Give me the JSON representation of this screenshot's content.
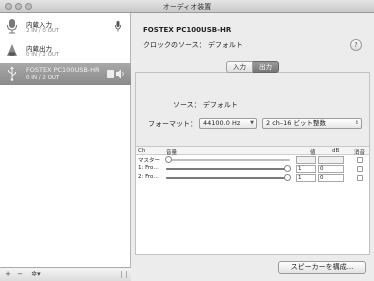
{
  "window": {
    "title": "オーディオ装置"
  },
  "sidebar": {
    "devices": [
      {
        "name": "内蔵入力",
        "io": "2 IN / 0 OUT",
        "icon": "microphone-icon",
        "selected": false
      },
      {
        "name": "内蔵出力",
        "io": "0 IN / 2 OUT",
        "icon": "speaker-icon",
        "selected": false
      },
      {
        "name": "FOSTEX PC100USB-HR",
        "io": "0 IN / 2 OUT",
        "icon": "usb-icon",
        "selected": true
      }
    ],
    "footer": {
      "add": "+",
      "remove": "−",
      "gear": "✲▾"
    }
  },
  "main": {
    "device_title": "FOSTEX PC100USB-HR",
    "clock_source": "クロックのソース： デフォルト",
    "help": "?",
    "tabs": [
      {
        "label": "入力",
        "active": false
      },
      {
        "label": "出力",
        "active": true
      }
    ],
    "source": "ソース： デフォルト",
    "format_label": "フォーマット：",
    "sample_rate": "44100.0 Hz",
    "channel_format": "2 ch–16 ビット整数",
    "table": {
      "headers": {
        "ch": "Ch",
        "volume": "音量",
        "value": "値",
        "db": "dB",
        "mute": "消音"
      },
      "rows": [
        {
          "label": "マスター",
          "level": 0,
          "value": "",
          "db": ""
        },
        {
          "label": "1: Fro…",
          "level": 1,
          "value": "1",
          "db": "0"
        },
        {
          "label": "2: Fro…",
          "level": 1,
          "value": "1",
          "db": "0"
        }
      ]
    },
    "configure_button": "スピーカーを構成..."
  }
}
